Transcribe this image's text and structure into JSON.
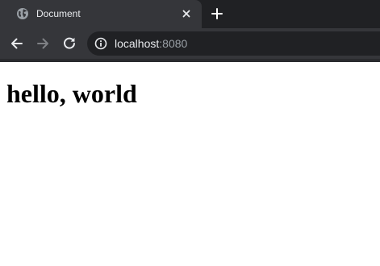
{
  "browser": {
    "tab": {
      "title": "Document",
      "favicon": "globe-icon"
    },
    "toolbar": {
      "back_icon": "arrow-left-icon",
      "forward_icon": "arrow-right-icon",
      "reload_icon": "reload-icon",
      "address": {
        "host": "localhost",
        "port": ":8080",
        "security_icon": "info-icon"
      }
    },
    "colors": {
      "tabstrip": "#202124",
      "active_tab": "#35363a",
      "omnibox": "#202124",
      "text": "#e8eaed",
      "muted_text": "#9aa0a6"
    }
  },
  "page": {
    "heading": "hello, world"
  }
}
